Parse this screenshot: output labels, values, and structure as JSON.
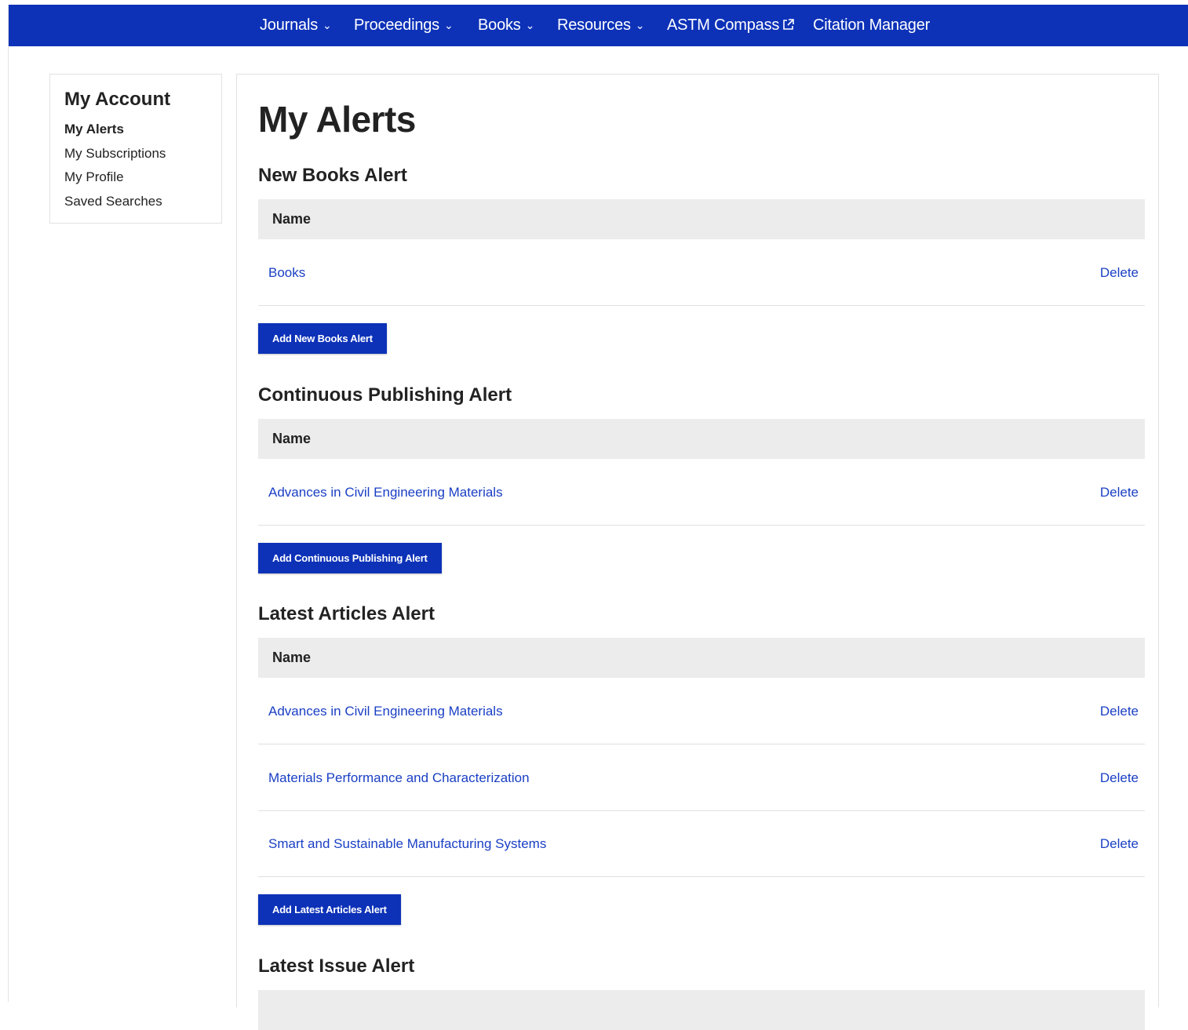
{
  "nav": {
    "items": [
      {
        "label": "Journals",
        "icon": "chevron-down-icon"
      },
      {
        "label": "Proceedings",
        "icon": "chevron-down-icon"
      },
      {
        "label": "Books",
        "icon": "chevron-down-icon"
      },
      {
        "label": "Resources",
        "icon": "chevron-down-icon"
      },
      {
        "label": "ASTM Compass",
        "icon": "external-link-icon"
      },
      {
        "label": "Citation Manager"
      }
    ]
  },
  "sidebar": {
    "title": "My Account",
    "items": [
      {
        "label": "My Alerts",
        "active": true
      },
      {
        "label": "My Subscriptions"
      },
      {
        "label": "My Profile"
      },
      {
        "label": "Saved Searches"
      }
    ]
  },
  "main": {
    "title": "My Alerts",
    "sections": [
      {
        "title": "New Books Alert",
        "column": "Name",
        "rows": [
          {
            "name": "Books",
            "action": "Delete"
          }
        ],
        "button": "Add New Books Alert"
      },
      {
        "title": "Continuous Publishing Alert",
        "column": "Name",
        "rows": [
          {
            "name": "Advances in Civil Engineering Materials",
            "action": "Delete"
          }
        ],
        "button": "Add Continuous Publishing Alert"
      },
      {
        "title": "Latest Articles Alert",
        "column": "Name",
        "rows": [
          {
            "name": "Advances in Civil Engineering Materials",
            "action": "Delete"
          },
          {
            "name": "Materials Performance and Characterization",
            "action": "Delete"
          },
          {
            "name": "Smart and Sustainable Manufacturing Systems",
            "action": "Delete"
          }
        ],
        "button": "Add Latest Articles Alert"
      },
      {
        "title": "Latest Issue Alert"
      }
    ]
  },
  "colors": {
    "brand": "#0d32b8",
    "link": "#1a3fc4",
    "header_bg": "#ececec"
  }
}
